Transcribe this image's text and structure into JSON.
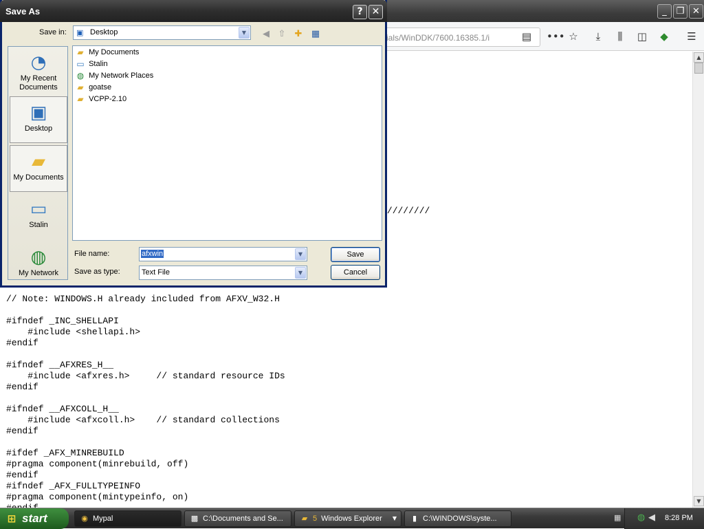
{
  "browser": {
    "url_fragment": "ials/WinDDK/7600.16385.1/i",
    "window_controls": {
      "minimize": "_",
      "restore": "❐",
      "close": "✕"
    },
    "toolbar_icons": [
      "reader-view-icon",
      "more-actions-icon",
      "bookmark-star-icon",
      "download-icon",
      "library-icon",
      "sidebar-icon",
      "extension-icon",
      "menu-icon"
    ],
    "code_lines": [
      "",
      "",
      "",
      "",
      "",
      "",
      "",
      "",
      "",
      "",
      "",
      "",
      "",
      "",
      "                                                                       ////////",
      "",
      "",
      "",
      "",
      "",
      "",
      "",
      "// Note: WINDOWS.H already included from AFXV_W32.H",
      "",
      "#ifndef _INC_SHELLAPI",
      "    #include <shellapi.h>",
      "#endif",
      "",
      "#ifndef __AFXRES_H__",
      "    #include <afxres.h>     // standard resource IDs",
      "#endif",
      "",
      "#ifndef __AFXCOLL_H__",
      "    #include <afxcoll.h>    // standard collections",
      "#endif",
      "",
      "#ifdef _AFX_MINREBUILD",
      "#pragma component(minrebuild, off)",
      "#endif",
      "#ifndef _AFX_FULLTYPEINFO",
      "#pragma component(mintypeinfo, on)",
      "#endif"
    ]
  },
  "dialog": {
    "title": "Save As",
    "title_buttons": {
      "help": "?",
      "close": "✕"
    },
    "save_in_label": "Save in:",
    "save_in_value": "Desktop",
    "places": [
      {
        "label": "My Recent Documents",
        "icon": "recent-documents-icon"
      },
      {
        "label": "Desktop",
        "icon": "desktop-icon"
      },
      {
        "label": "My Documents",
        "icon": "my-documents-icon"
      },
      {
        "label": "Stalin",
        "icon": "my-computer-icon"
      },
      {
        "label": "My Network",
        "icon": "my-network-icon"
      }
    ],
    "files": [
      {
        "label": "My Documents",
        "icon": "folder-documents-icon"
      },
      {
        "label": "Stalin",
        "icon": "computer-icon"
      },
      {
        "label": "My Network Places",
        "icon": "network-places-icon"
      },
      {
        "label": "goatse",
        "icon": "folder-icon"
      },
      {
        "label": "VCPP-2.10",
        "icon": "folder-icon"
      }
    ],
    "file_name_label": "File name:",
    "file_name_value": "afxwin",
    "save_as_type_label": "Save as type:",
    "save_as_type_value": "Text File",
    "save_button": "Save",
    "cancel_button": "Cancel"
  },
  "taskbar": {
    "start_label": "start",
    "tasks": [
      {
        "label": "Mypal",
        "icon": "browser-icon"
      },
      {
        "label": "C:\\Documents and Se...",
        "icon": "7zip-icon"
      },
      {
        "label": "Windows Explorer",
        "count": "5",
        "icon": "folder-icon"
      },
      {
        "label": "C:\\WINDOWS\\syste...",
        "icon": "console-icon"
      }
    ],
    "clock": "8:28 PM"
  },
  "colors": {
    "dialog_bg": "#ece9d8",
    "selection": "#316ac5",
    "taskbar": "#3a3a3a"
  }
}
